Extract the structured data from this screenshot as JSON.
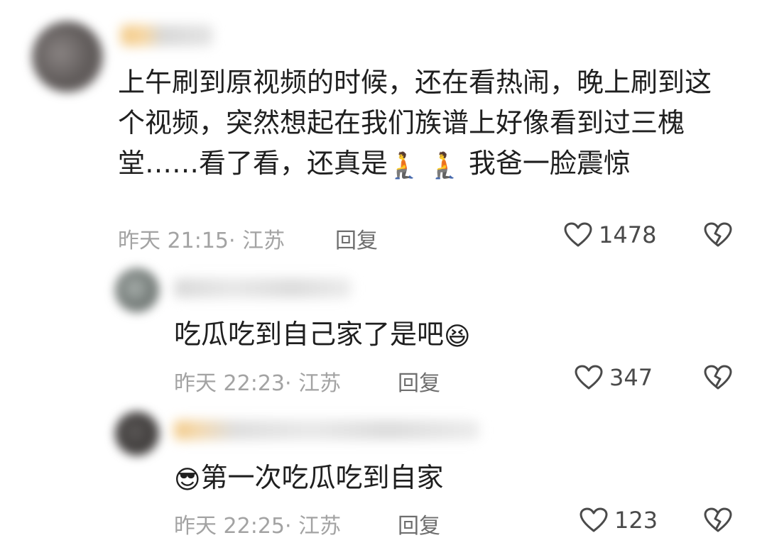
{
  "comments": [
    {
      "text": "上午刷到原视频的时候，还在看热闹，晚上刷到这个视频，突然想起在我们族谱上好像看到过三槐堂……看了看，还真是",
      "emoji_1": "🧎",
      "emoji_2": "🧎",
      "text_tail": "我爸一脸震惊",
      "time_location": "昨天 21:15· 江苏",
      "reply_label": "回复",
      "like_count": "1478"
    },
    {
      "text": "吃瓜吃到自己家了是吧",
      "emoji": "😆",
      "time_location": "昨天 22:23· 江苏",
      "reply_label": "回复",
      "like_count": "347"
    },
    {
      "emoji": "😎",
      "text": "第一次吃瓜吃到自家",
      "time_location": "昨天 22:25· 江苏",
      "reply_label": "回复",
      "like_count": "123"
    }
  ],
  "icons": {
    "like": "heart-outline-icon",
    "dislike": "broken-heart-icon"
  },
  "colors": {
    "meta_text": "#a3a3a3",
    "body_text": "#1f1f1f"
  }
}
